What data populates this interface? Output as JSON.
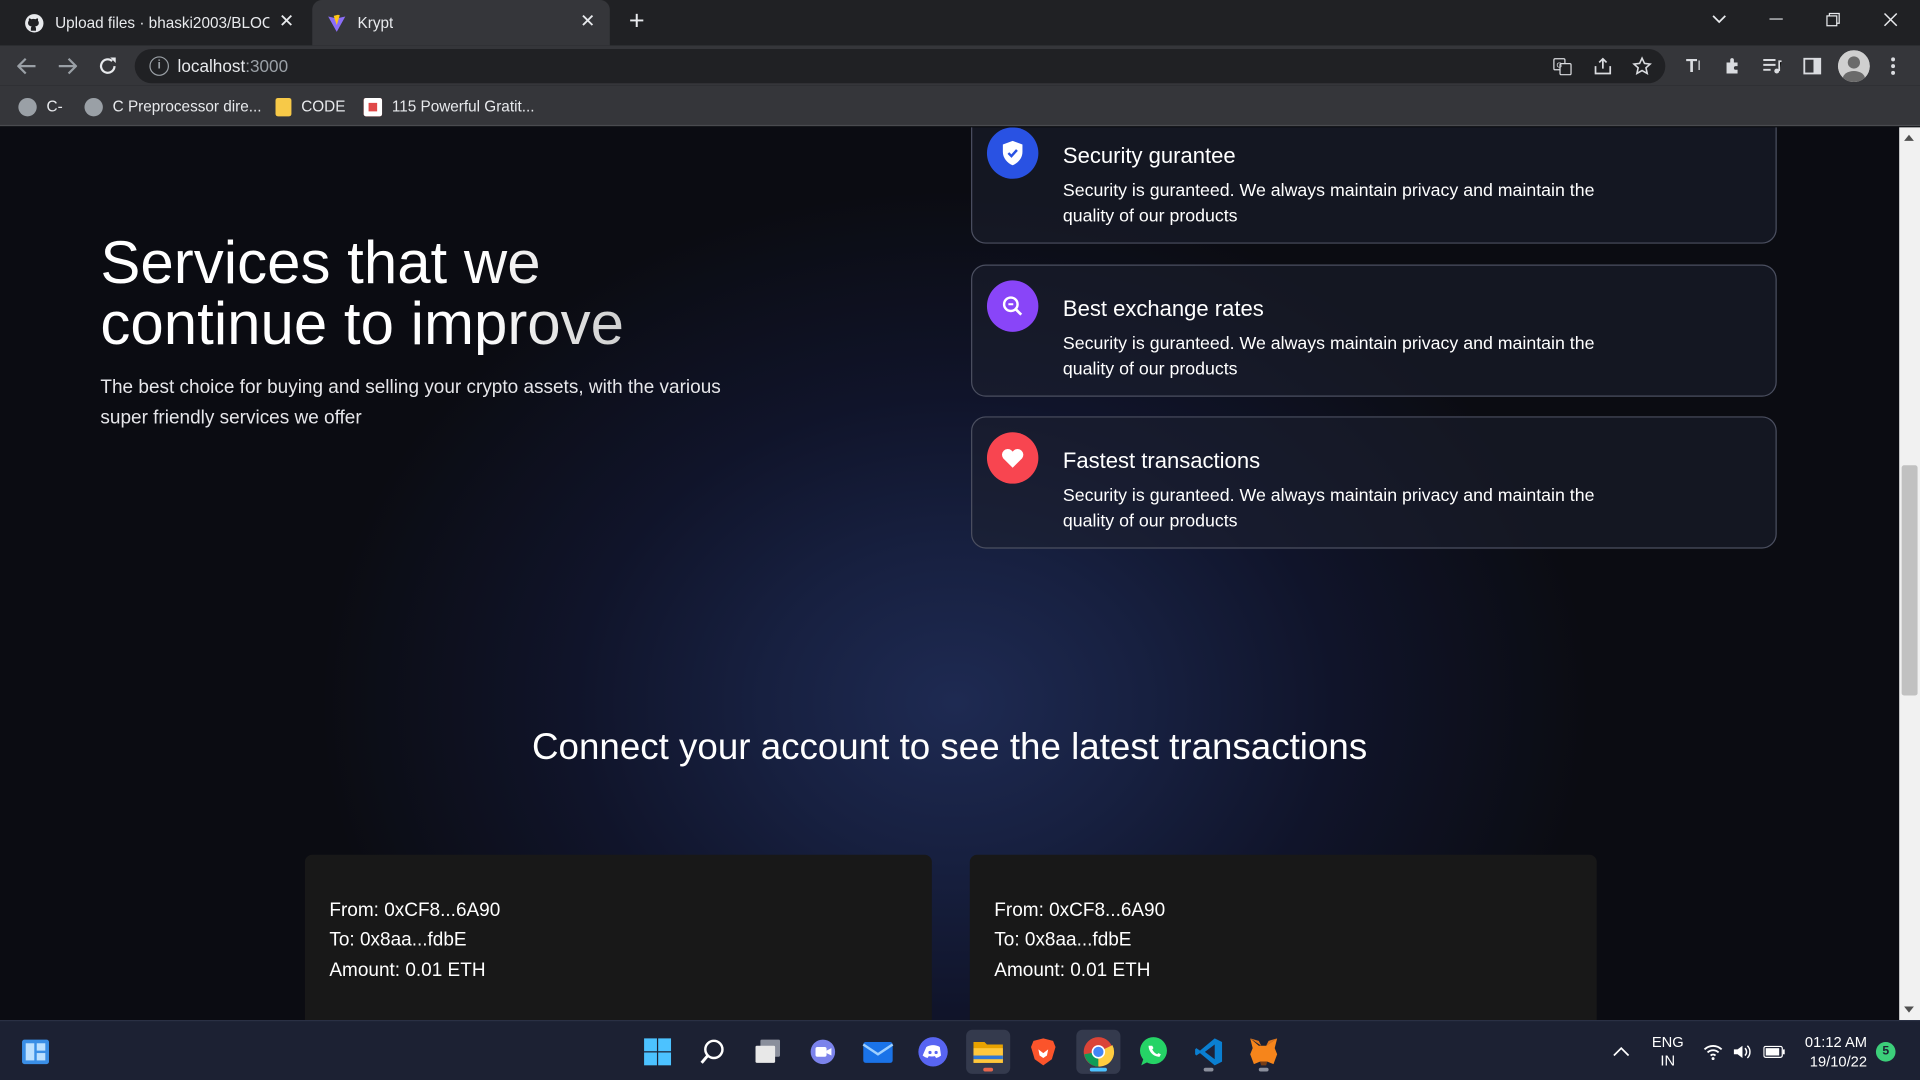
{
  "browser": {
    "tabs": [
      {
        "title": "Upload files · bhaski2003/BLOCK",
        "icon": "github-icon",
        "active": false
      },
      {
        "title": "Krypt",
        "icon": "vite-icon",
        "active": true
      }
    ],
    "url_host": "localhost",
    "url_port": ":3000",
    "bookmarks": [
      {
        "label": "C-",
        "icon": "globe-icon"
      },
      {
        "label": "C Preprocessor dire...",
        "icon": "globe-icon"
      },
      {
        "label": "CODE",
        "icon": "folder-icon"
      },
      {
        "label": "115 Powerful Gratit...",
        "icon": "site-icon"
      }
    ]
  },
  "hero": {
    "title_line1": "Services that we",
    "title_line2": "continue to improve",
    "subtitle": "The best choice for buying and selling your crypto assets, with the various super friendly services we offer"
  },
  "services": [
    {
      "title": "Security gurantee",
      "desc": "Security is guranteed. We always maintain privacy and maintain the quality of our products",
      "color": "#2952e3",
      "icon": "shield-icon"
    },
    {
      "title": "Best exchange rates",
      "desc": "Security is guranteed. We always maintain privacy and maintain the quality of our products",
      "color": "#8945f8",
      "icon": "search-icon"
    },
    {
      "title": "Fastest transactions",
      "desc": "Security is guranteed. We always maintain privacy and maintain the quality of our products",
      "color": "#f84550",
      "icon": "heart-icon"
    }
  ],
  "connect_heading": "Connect your account to see the latest transactions",
  "transactions": [
    {
      "from": "From: 0xCF8...6A90",
      "to": "To: 0x8aa...fdbE",
      "amount": "Amount: 0.01 ETH"
    },
    {
      "from": "From: 0xCF8...6A90",
      "to": "To: 0x8aa...fdbE",
      "amount": "Amount: 0.01 ETH"
    }
  ],
  "taskbar": {
    "language": "ENG",
    "region": "IN",
    "time": "01:12 AM",
    "date": "19/10/22",
    "notification_count": "5"
  }
}
